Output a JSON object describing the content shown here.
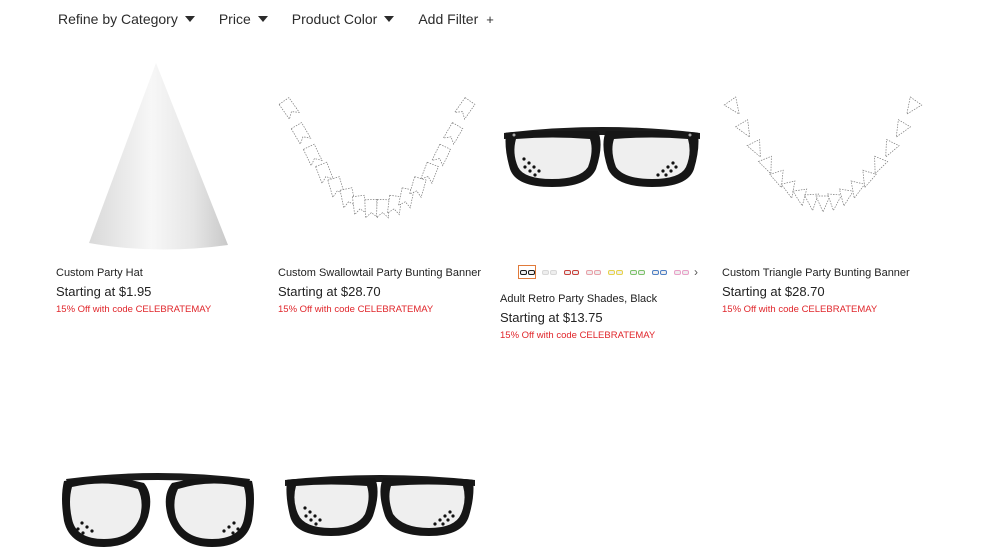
{
  "filters": [
    {
      "label": "Refine by Category",
      "kind": "dropdown"
    },
    {
      "label": "Price",
      "kind": "dropdown"
    },
    {
      "label": "Product Color",
      "kind": "dropdown"
    },
    {
      "label": "Add Filter",
      "kind": "add"
    }
  ],
  "products": [
    {
      "title": "Custom Party Hat",
      "price": "Starting at $1.95",
      "promo": "15% Off with code CELEBRATEMAY",
      "image": "party-hat-image"
    },
    {
      "title": "Custom Swallowtail Party Bunting Banner",
      "price": "Starting at $28.70",
      "promo": "15% Off with code CELEBRATEMAY",
      "image": "swallowtail-bunting-image"
    },
    {
      "title": "Adult Retro Party Shades, Black",
      "price": "Starting at $13.75",
      "promo": "15% Off with code CELEBRATEMAY",
      "image": "retro-shades-image",
      "swatches": [
        "#1a1a1a",
        "#d8d8d8",
        "#c8403a",
        "#e8a0a8",
        "#e6d24a",
        "#7cc26a",
        "#4d7fc4",
        "#e8a0c8"
      ]
    },
    {
      "title": "Custom Triangle Party Bunting Banner",
      "price": "Starting at $28.70",
      "promo": "15% Off with code CELEBRATEMAY",
      "image": "triangle-bunting-image"
    },
    {
      "image": "aviator-shades-image"
    },
    {
      "image": "retro-shades-image"
    }
  ],
  "colors": {
    "promo": "#e0262b",
    "selected_swatch": "#e07a3a"
  }
}
